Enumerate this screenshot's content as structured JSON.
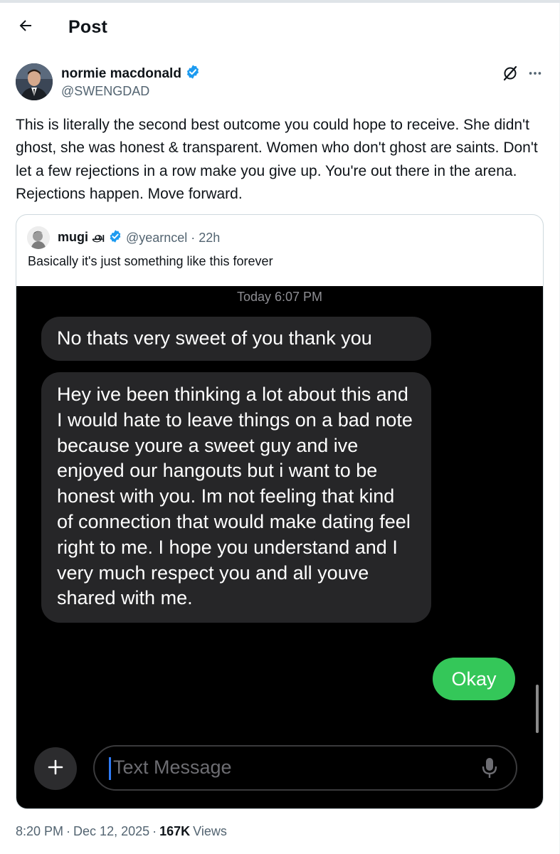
{
  "header": {
    "back_icon": "arrow-left-icon",
    "title": "Post"
  },
  "post": {
    "author_name": "normie macdonald",
    "verified": true,
    "handle": "@SWENGDAD",
    "text": "This is literally the second best outcome you could hope to receive. She didn't ghost, she was honest & transparent. Women who don't ghost are saints. Don't let a few rejections in a row make you give up. You're out there in the arena. Rejections happen. Move forward.",
    "time": "8:20 PM",
    "date": "Dec 12, 2025",
    "views_count": "167K",
    "views_label": "Views"
  },
  "quote": {
    "name": "mugi ௮",
    "verified": true,
    "handle": "@yearncel",
    "age": "22h",
    "text": "Basically it's just something like this forever",
    "screenshot": {
      "timestamp": "Today 6:07 PM",
      "incoming": [
        "No thats very sweet of you thank you",
        "Hey ive been thinking a lot about this and I would hate to leave things on a bad note because youre a sweet guy and ive enjoyed our hangouts but i want to be honest with you. Im not feeling that kind of connection that would make dating feel right to me. I hope you understand and I very much respect you and all youve shared with me."
      ],
      "outgoing": [
        "Okay"
      ],
      "input_placeholder": "Text Message"
    }
  },
  "colors": {
    "verified_blue": "#1d9bf0",
    "imessage_green": "#34c759",
    "bubble_gray": "#262628",
    "muted_text": "#536471"
  }
}
